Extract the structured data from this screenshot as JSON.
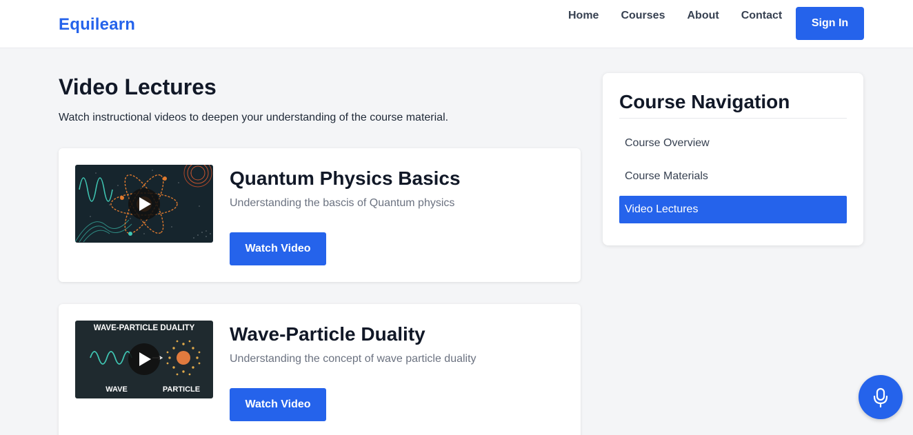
{
  "header": {
    "logo": "Equilearn",
    "nav": [
      {
        "label": "Home"
      },
      {
        "label": "Courses"
      },
      {
        "label": "About"
      },
      {
        "label": "Contact"
      }
    ],
    "signin_label": "Sign In"
  },
  "main": {
    "title": "Video Lectures",
    "subtitle": "Watch instructional videos to deepen your understanding of the course material.",
    "videos": [
      {
        "title": "Quantum Physics Basics",
        "description": "Understanding the bascis of Quantum physics",
        "button_label": "Watch Video"
      },
      {
        "title": "Wave-Particle Duality",
        "description": "Understanding the concept of wave particle duality",
        "button_label": "Watch Video",
        "thumb_heading": "WAVE-PARTICLE DUALITY",
        "thumb_left_label": "WAVE",
        "thumb_right_label": "PARTICLE"
      }
    ]
  },
  "sidebar": {
    "title": "Course Navigation",
    "items": [
      {
        "label": "Course Overview",
        "active": false
      },
      {
        "label": "Course Materials",
        "active": false
      },
      {
        "label": "Video Lectures",
        "active": true
      }
    ]
  },
  "icons": {
    "play": "play-icon",
    "mic": "microphone-icon"
  },
  "colors": {
    "accent": "#2563eb",
    "background": "#f4f5f7"
  }
}
